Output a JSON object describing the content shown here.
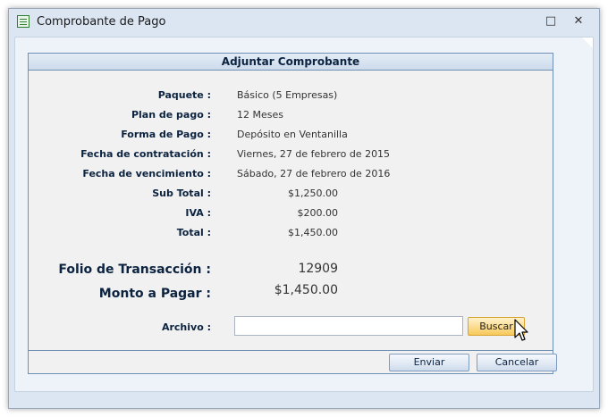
{
  "window": {
    "title": "Comprobante de Pago",
    "icon": "document-icon",
    "maximize_glyph": "□",
    "close_glyph": "✕"
  },
  "panel": {
    "heading": "Adjuntar Comprobante",
    "rows": [
      {
        "label": "Paquete :",
        "value": "Básico (5 Empresas)"
      },
      {
        "label": "Plan de pago :",
        "value": "12 Meses"
      },
      {
        "label": "Forma de Pago :",
        "value": "Depósito en Ventanilla"
      },
      {
        "label": "Fecha de contratación :",
        "value": "Viernes, 27 de febrero de 2015"
      },
      {
        "label": "Fecha de vencimiento :",
        "value": "Sábado, 27 de febrero de 2016"
      }
    ],
    "amounts": [
      {
        "label": "Sub Total :",
        "value": "$1,250.00"
      },
      {
        "label": "IVA :",
        "value": "$200.00"
      },
      {
        "label": "Total :",
        "value": "$1,450.00"
      }
    ],
    "folio_label": "Folio de Transacción :",
    "folio_value": "12909",
    "monto_label": "Monto a Pagar :",
    "monto_value": "$1,450.00",
    "archivo_label": "Archivo :",
    "archivo_value": "",
    "buscar_label": "Buscar",
    "enviar_label": "Enviar",
    "cancelar_label": "Cancelar"
  },
  "colors": {
    "label_text": "#0c2340",
    "window_frame": "#dce6f3",
    "buscar_button": "#f7c95b"
  }
}
